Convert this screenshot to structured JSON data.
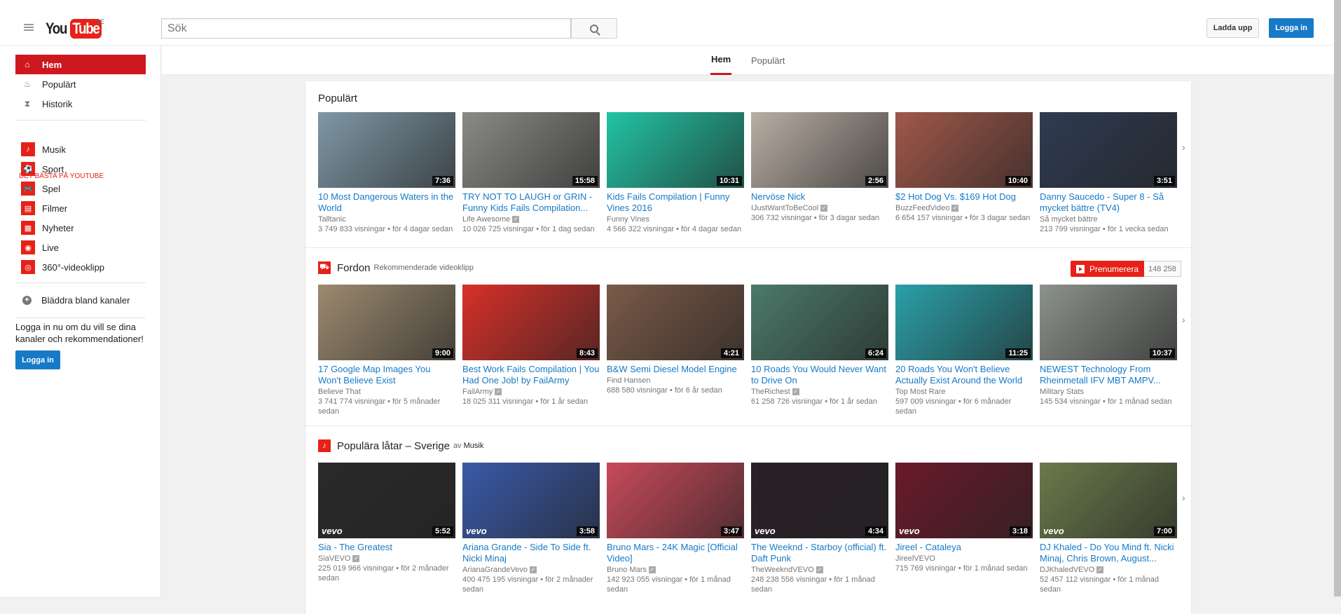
{
  "header": {
    "logo_you": "You",
    "logo_tube": "Tube",
    "country": "SE",
    "search_placeholder": "Sök",
    "upload_label": "Ladda upp",
    "signin_label": "Logga in"
  },
  "sidebar": {
    "main": [
      {
        "label": "Hem",
        "icon": "home-icon",
        "glyph": "⌂",
        "active": true
      },
      {
        "label": "Populärt",
        "icon": "flame-icon",
        "glyph": "♨"
      },
      {
        "label": "Historik",
        "icon": "hourglass-icon",
        "glyph": "⧗"
      }
    ],
    "best_heading": "DET BÄSTA PÅ YOUTUBE",
    "best": [
      {
        "label": "Musik",
        "icon": "music-icon",
        "glyph": "♪"
      },
      {
        "label": "Sport",
        "icon": "sport-ball-icon",
        "glyph": "⚽"
      },
      {
        "label": "Spel",
        "icon": "gamepad-icon",
        "glyph": "🎮"
      },
      {
        "label": "Filmer",
        "icon": "film-icon",
        "glyph": "▤"
      },
      {
        "label": "Nyheter",
        "icon": "news-icon",
        "glyph": "▦"
      },
      {
        "label": "Live",
        "icon": "live-icon",
        "glyph": "◉"
      },
      {
        "label": "360°-videoklipp",
        "icon": "360-icon",
        "glyph": "◎"
      }
    ],
    "browse_label": "Bläddra bland kanaler",
    "signin_text": "Logga in nu om du vill se dina kanaler och rekommendationer!",
    "signin_button": "Logga in"
  },
  "tabs": [
    {
      "label": "Hem",
      "active": true
    },
    {
      "label": "Populärt"
    }
  ],
  "colors": {
    "brand_red": "#e62117",
    "active_red": "#cc181e",
    "link_blue": "#167ac6"
  },
  "sections": [
    {
      "title": "Populärt",
      "videos": [
        {
          "title": "10 Most Dangerous Waters in the World",
          "channel": "Talltanic",
          "verified": false,
          "views": "3 749 833 visningar",
          "age": "för 4 dagar sedan",
          "duration": "7:36",
          "thumb_color": "#7f98a6"
        },
        {
          "title": "TRY NOT TO LAUGH or GRIN - Funny Kids Fails Compilation...",
          "channel": "Life Awesome",
          "verified": true,
          "views": "10 026 725 visningar",
          "age": "för 1 dag sedan",
          "duration": "15:58",
          "thumb_color": "#8a8a86"
        },
        {
          "title": "Kids Fails Compilation | Funny Vines 2016",
          "channel": "Funny Vines",
          "verified": false,
          "views": "4 566 322 visningar",
          "age": "för 4 dagar sedan",
          "duration": "10:31",
          "thumb_color": "#22c4a4"
        },
        {
          "title": "Nervöse Nick",
          "channel": "IJustWantToBeCool",
          "verified": true,
          "views": "306 732 visningar",
          "age": "för 3 dagar sedan",
          "duration": "2:56",
          "thumb_color": "#b9aea4"
        },
        {
          "title": "$2 Hot Dog Vs. $169 Hot Dog",
          "channel": "BuzzFeedVideo",
          "verified": true,
          "views": "6 654 157 visningar",
          "age": "för 3 dagar sedan",
          "duration": "10:40",
          "thumb_color": "#a0584a"
        },
        {
          "title": "Danny Saucedo - Super 8 - Så mycket bättre (TV4)",
          "channel": "Så mycket bättre",
          "verified": false,
          "views": "213 799 visningar",
          "age": "för 1 vecka sedan",
          "duration": "3:51",
          "thumb_color": "#2f3b52"
        }
      ]
    },
    {
      "title": "Fordon",
      "subtitle": "Rekommenderade videoklipp",
      "icon": "car-icon",
      "subscribe_label": "Prenumerera",
      "subscriber_count": "148 258",
      "videos": [
        {
          "title": "17 Google Map Images You Won't Believe Exist",
          "channel": "Believe That",
          "verified": false,
          "views": "3 741 774 visningar",
          "age": "för 5 månader sedan",
          "duration": "9:00",
          "thumb_color": "#9c8a70"
        },
        {
          "title": "Best Work Fails Compilation | You Had One Job! by FailArmy",
          "channel": "FailArmy",
          "verified": true,
          "views": "18 025 311 visningar",
          "age": "för 1 år sedan",
          "duration": "8:43",
          "thumb_color": "#d8302a"
        },
        {
          "title": "B&W Semi Diesel Model Engine",
          "channel": "Find Hansen",
          "verified": false,
          "views": "688 580 visningar",
          "age": "för 6 år sedan",
          "duration": "4:21",
          "thumb_color": "#7a5a48"
        },
        {
          "title": "10 Roads You Would Never Want to Drive On",
          "channel": "TheRichest",
          "verified": true,
          "views": "61 258 726 visningar",
          "age": "för 1 år sedan",
          "duration": "6:24",
          "thumb_color": "#4c7a6a"
        },
        {
          "title": "20 Roads You Won't Believe Actually Exist Around the World",
          "channel": "Top Most Rare",
          "verified": false,
          "views": "597 009 visningar",
          "age": "för 6 månader sedan",
          "duration": "11:25",
          "thumb_color": "#2aa0a8"
        },
        {
          "title": "NEWEST Technology From Rheinmetall IFV MBT AMPV...",
          "channel": "Military Stats",
          "verified": false,
          "views": "145 534 visningar",
          "age": "för 1 månad sedan",
          "duration": "10:37",
          "thumb_color": "#8c928c"
        }
      ]
    },
    {
      "title": "Populära låtar – Sverige",
      "by": "av",
      "by_channel": "Musik",
      "icon": "music-icon",
      "videos": [
        {
          "title": "Sia - The Greatest",
          "channel": "SiaVEVO",
          "verified": true,
          "views": "225 019 966 visningar",
          "age": "för 2 månader sedan",
          "duration": "5:52",
          "vevo": "vevo",
          "thumb_color": "#2a2a2a"
        },
        {
          "title": "Ariana Grande - Side To Side ft. Nicki Minaj",
          "channel": "ArianaGrandeVevo",
          "verified": true,
          "views": "400 475 195 visningar",
          "age": "för 2 månader sedan",
          "duration": "3:58",
          "vevo": "vevo",
          "thumb_color": "#3a5aa8"
        },
        {
          "title": "Bruno Mars - 24K Magic [Official Video]",
          "channel": "Bruno Mars",
          "verified": true,
          "views": "142 923 055 visningar",
          "age": "för 1 månad sedan",
          "duration": "3:47",
          "thumb_color": "#c84a5a"
        },
        {
          "title": "The Weeknd - Starboy (official) ft. Daft Punk",
          "channel": "TheWeekndVEVO",
          "verified": true,
          "views": "248 238 556 visningar",
          "age": "för 1 månad sedan",
          "duration": "4:34",
          "vevo": "vevo",
          "thumb_color": "#2a2028"
        },
        {
          "title": "Jireel - Cataleya",
          "channel": "JireelVEVO",
          "verified": false,
          "views": "715 769 visningar",
          "age": "för 1 månad sedan",
          "duration": "3:18",
          "vevo": "vevo",
          "thumb_color": "#6a1a2a"
        },
        {
          "title": "DJ Khaled - Do You Mind ft. Nicki Minaj, Chris Brown, August...",
          "channel": "DJKhaledVEVO",
          "verified": true,
          "views": "52 457 112 visningar",
          "age": "för 1 månad sedan",
          "duration": "7:00",
          "vevo": "vevo",
          "thumb_color": "#6a7a4a"
        }
      ]
    }
  ]
}
